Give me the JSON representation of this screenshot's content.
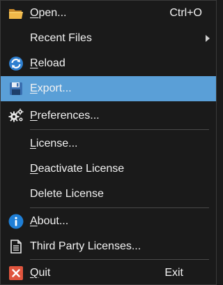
{
  "menu": {
    "items": [
      {
        "label": "Open...",
        "mnemonic": "O",
        "rest": "pen...",
        "shortcut": "Ctrl+O",
        "icon": "folder-icon"
      },
      {
        "label": "Recent Files",
        "has_submenu": true
      },
      {
        "label": "Reload",
        "mnemonic": "R",
        "rest": "eload",
        "icon": "reload-icon"
      },
      {
        "label": "Export...",
        "mnemonic": "E",
        "rest": "xport...",
        "icon": "floppy-disk-icon",
        "selected": true
      },
      {
        "label": "Preferences...",
        "mnemonic": "P",
        "rest": "references...",
        "icon": "gears-icon"
      },
      {
        "label": "License...",
        "mnemonic": "L",
        "rest": "icense..."
      },
      {
        "label": "Deactivate License",
        "mnemonic": "D",
        "rest": "eactivate License"
      },
      {
        "label": "Delete License"
      },
      {
        "label": "About...",
        "mnemonic": "A",
        "rest": "bout...",
        "icon": "info-icon"
      },
      {
        "label": "Third Party Licenses...",
        "icon": "document-icon"
      },
      {
        "label": "Quit",
        "mnemonic": "Q",
        "rest": "uit",
        "shortcut": "Exit",
        "icon": "close-icon"
      }
    ]
  },
  "colors": {
    "background": "#1a1a1a",
    "highlight": "#5a9fd7",
    "text": "#f2f2f2"
  }
}
